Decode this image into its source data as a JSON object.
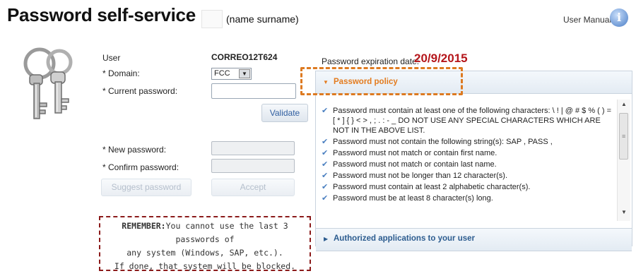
{
  "header": {
    "title": "Password self-service",
    "name_placeholder": "(name surname)",
    "manual_label": "User Manual",
    "info_glyph": "i"
  },
  "form": {
    "user_label": "User",
    "user_value": "CORREO12T624",
    "domain_label": "* Domain:",
    "domain_value": "FCC",
    "current_password_label": "* Current password:",
    "validate_label": "Validate",
    "new_password_label": "* New password:",
    "confirm_password_label": "* Confirm password:",
    "suggest_label": "Suggest password",
    "accept_label": "Accept"
  },
  "reminder": {
    "lead": "REMEMBER:",
    "line1": "You cannot use the last 3 passwords of",
    "line2": "any system (Windows, SAP, etc.).",
    "line3": "If done, that system will be blocked."
  },
  "expiration": {
    "label": "Password expiration date:",
    "date": "20/9/2015"
  },
  "policy": {
    "title": "Password policy",
    "rules": [
      "Password must contain at least one of the following characters: \\ ! | @ # $ % ( ) = [ * ] { } < > , ; . : - _ DO NOT USE ANY SPECIAL CHARACTERS WHICH ARE NOT IN THE ABOVE LIST.",
      "Password must not contain the following string(s): SAP , PASS ,",
      "Password must not match or contain first name.",
      "Password must not match or contain last name.",
      "Password must not be longer than 12 character(s).",
      "Password must contain at least 2 alphabetic character(s).",
      "Password must be at least 8 character(s) long."
    ]
  },
  "authorized": {
    "title": "Authorized applications to your user"
  },
  "colors": {
    "expiry_red": "#b5161b",
    "policy_orange": "#e37b1e",
    "link_blue": "#2c5c8f",
    "reminder_border": "#8b1a1a"
  }
}
